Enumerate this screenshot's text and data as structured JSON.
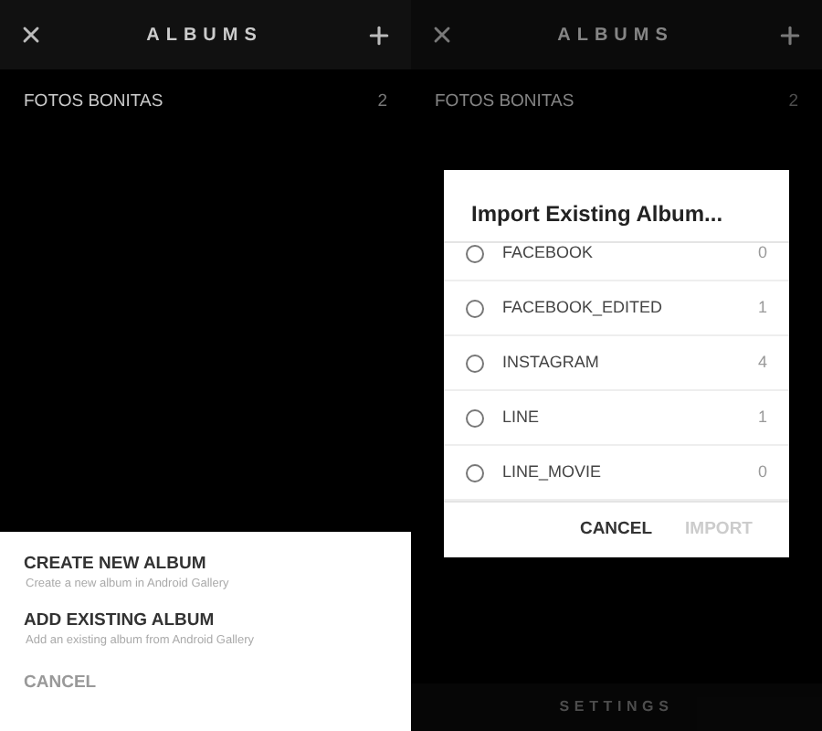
{
  "screens": [
    {
      "header": {
        "title": "ALBUMS"
      },
      "albums": [
        {
          "name": "FOTOS BONITAS",
          "count": "2"
        }
      ],
      "sheet": {
        "actions": [
          {
            "title": "CREATE NEW ALBUM",
            "subtitle": "Create a new album in Android Gallery"
          },
          {
            "title": "ADD EXISTING ALBUM",
            "subtitle": "Add an existing album from Android Gallery"
          }
        ],
        "cancel": "CANCEL"
      }
    },
    {
      "header": {
        "title": "ALBUMS"
      },
      "albums": [
        {
          "name": "FOTOS BONITAS",
          "count": "2"
        }
      ],
      "dialog": {
        "title": "Import Existing Album...",
        "items": [
          {
            "name": "FACEBOOK",
            "count": "0",
            "selected": false
          },
          {
            "name": "FACEBOOK_EDITED",
            "count": "1",
            "selected": false
          },
          {
            "name": "INSTAGRAM",
            "count": "4",
            "selected": false
          },
          {
            "name": "LINE",
            "count": "1",
            "selected": false
          },
          {
            "name": "LINE_MOVIE",
            "count": "0",
            "selected": false
          }
        ],
        "buttons": [
          {
            "label": "CANCEL",
            "disabled": false
          },
          {
            "label": "IMPORT",
            "disabled": true
          }
        ]
      },
      "footer": "SETTINGS"
    }
  ]
}
